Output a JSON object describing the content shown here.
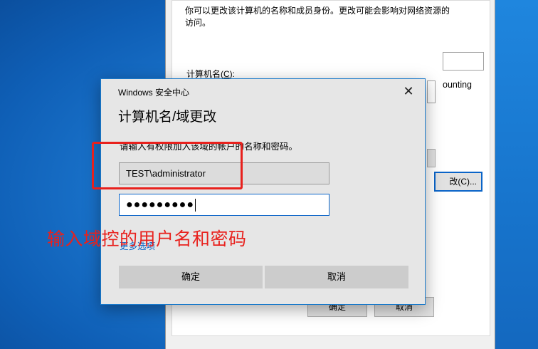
{
  "background_window": {
    "description": "你可以更改该计算机的名称和成员身份。更改可能会影响对网络资源的访问。",
    "computer_name_label": "计算机名(",
    "computer_name_hotkey": "C",
    "computer_name_label_end": "):",
    "fragment_text": "ounting",
    "change_button_label": "改(C)...",
    "ok_label": "确定",
    "cancel_label": "取消"
  },
  "dialog": {
    "window_title": "Windows 安全中心",
    "heading": "计算机名/域更改",
    "instruction": "请输入有权限加入该域的帐户的名称和密码。",
    "username_value": "TEST\\administrator",
    "password_value": "●●●●●●●●●",
    "more_options": "更多选项",
    "ok_label": "确定",
    "cancel_label": "取消",
    "close_glyph": "✕"
  },
  "annotation": {
    "text": "输入域控的用户名和密码",
    "color": "#e8211d"
  },
  "colors": {
    "accent": "#0a64c8",
    "dialog_border": "#1979ca"
  }
}
